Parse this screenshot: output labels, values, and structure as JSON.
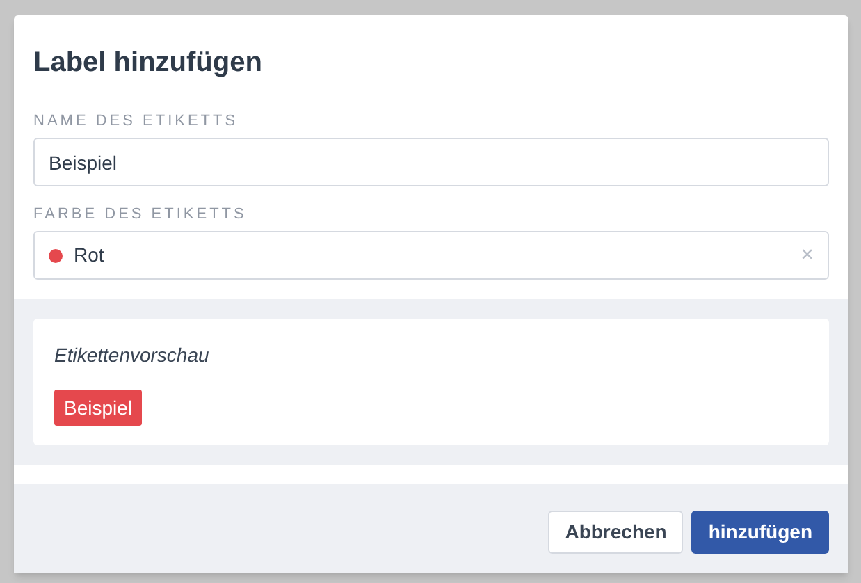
{
  "dialog": {
    "title": "Label hinzufügen"
  },
  "fields": [
    {
      "kind": "text",
      "label": "NAME DES ETIKETTS",
      "value": "Beispiel"
    },
    {
      "kind": "color",
      "label": "FARBE DES ETIKETTS",
      "value": "Rot",
      "color": "#e5484d",
      "clear": "×"
    }
  ],
  "preview": {
    "title": "Etikettenvorschau",
    "tag": "Beispiel"
  },
  "buttons": [
    {
      "kind": "secondary",
      "label": "Abbrechen"
    },
    {
      "kind": "primary",
      "label": "hinzufügen"
    }
  ]
}
